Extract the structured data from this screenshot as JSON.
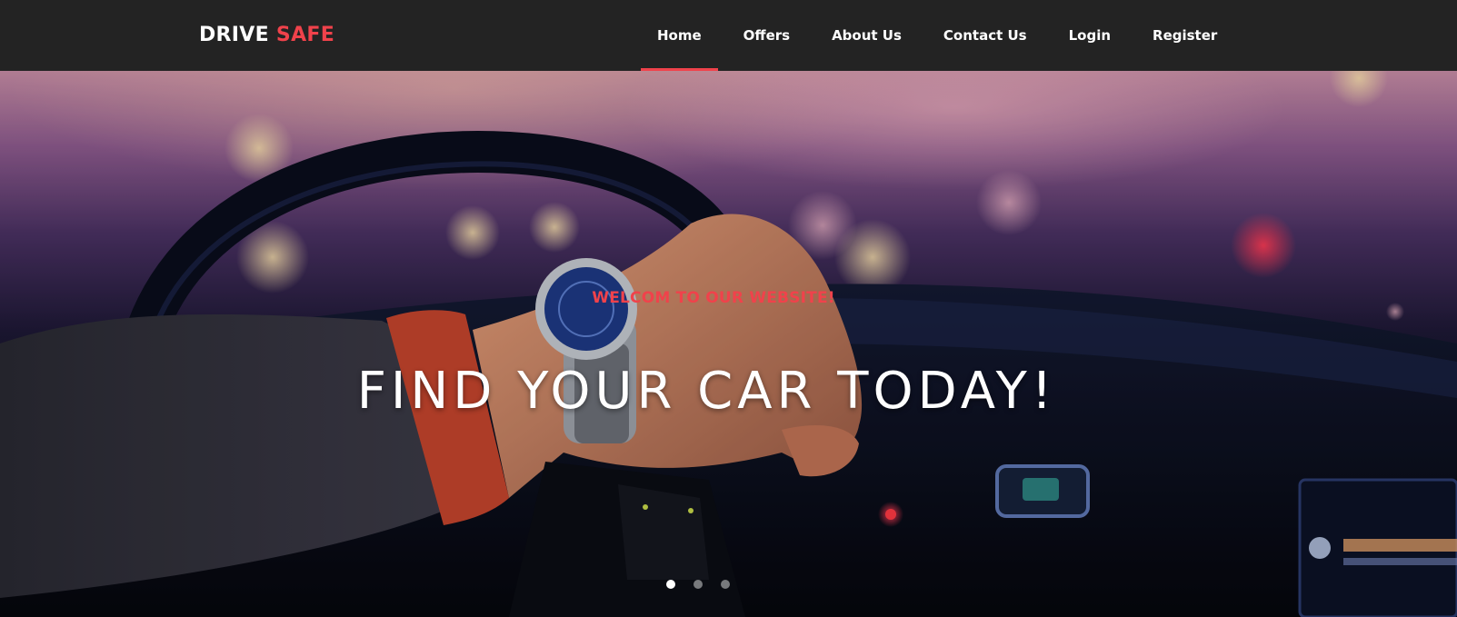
{
  "brand": {
    "name_part1": "DRIVE",
    "name_part2": "SAFE",
    "accent_color": "#f0424b"
  },
  "nav": {
    "items": [
      {
        "label": "Home",
        "active": true
      },
      {
        "label": "Offers",
        "active": false
      },
      {
        "label": "About Us",
        "active": false
      },
      {
        "label": "Contact Us",
        "active": false
      },
      {
        "label": "Login",
        "active": false
      },
      {
        "label": "Register",
        "active": false
      }
    ]
  },
  "hero": {
    "tagline": "WELCOM TO OUR WEBSITE!",
    "headline": "FIND YOUR CAR TODAY!",
    "slides": {
      "count": 3,
      "active_index": 0
    }
  },
  "colors": {
    "navbar_bg": "#232323",
    "text": "#ffffff",
    "accent": "#f0424b"
  }
}
